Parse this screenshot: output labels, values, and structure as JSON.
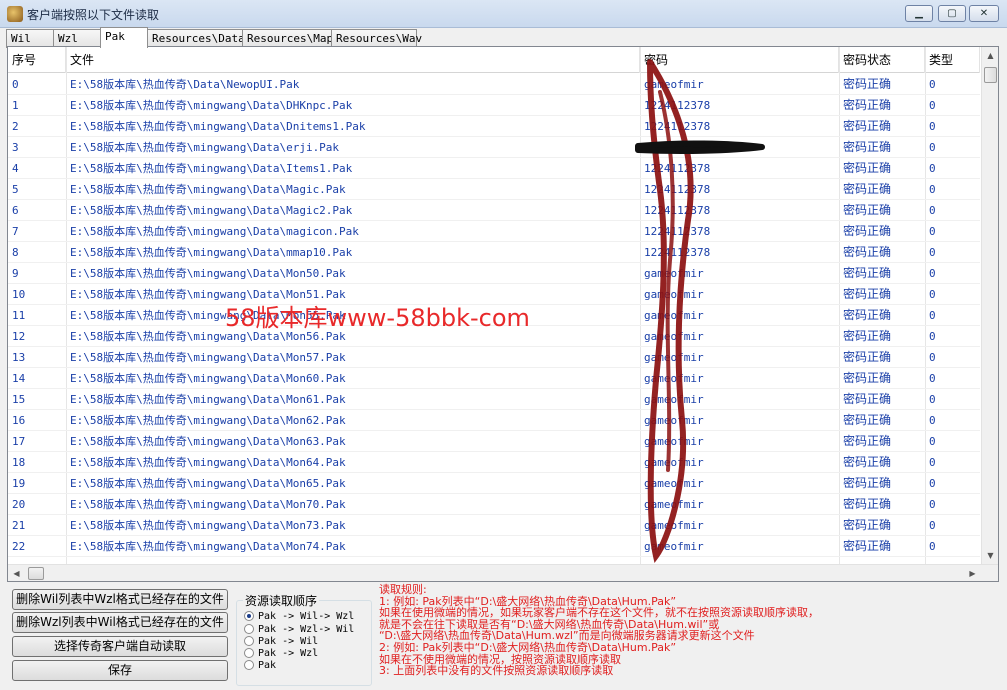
{
  "window": {
    "title": "客户端按照以下文件读取",
    "min_icon": "minimize-icon",
    "max_icon": "maximize-icon",
    "close_icon": "close-icon"
  },
  "tabs": [
    {
      "label": "Wil",
      "active": false
    },
    {
      "label": "Wzl",
      "active": false
    },
    {
      "label": "Pak",
      "active": true
    },
    {
      "label": "Resources\\Data",
      "active": false
    },
    {
      "label": "Resources\\Map",
      "active": false
    },
    {
      "label": "Resources\\Wav",
      "active": false
    }
  ],
  "table": {
    "headers": [
      "序号",
      "文件",
      "密码",
      "密码状态",
      "类型"
    ],
    "rows": [
      [
        "0",
        "E:\\58版本库\\热血传奇\\Data\\NewopUI.Pak",
        "gameofmir",
        "密码正确",
        "0"
      ],
      [
        "1",
        "E:\\58版本库\\热血传奇\\mingwang\\Data\\DHKnpc.Pak",
        "1224112378",
        "密码正确",
        "0"
      ],
      [
        "2",
        "E:\\58版本库\\热血传奇\\mingwang\\Data\\Dnitems1.Pak",
        "1224112378",
        "密码正确",
        "0"
      ],
      [
        "3",
        "E:\\58版本库\\热血传奇\\mingwang\\Data\\erji.Pak",
        "",
        "密码正确",
        "0"
      ],
      [
        "4",
        "E:\\58版本库\\热血传奇\\mingwang\\Data\\Items1.Pak",
        "1224112378",
        "密码正确",
        "0"
      ],
      [
        "5",
        "E:\\58版本库\\热血传奇\\mingwang\\Data\\Magic.Pak",
        "1224112378",
        "密码正确",
        "0"
      ],
      [
        "6",
        "E:\\58版本库\\热血传奇\\mingwang\\Data\\Magic2.Pak",
        "1224112378",
        "密码正确",
        "0"
      ],
      [
        "7",
        "E:\\58版本库\\热血传奇\\mingwang\\Data\\magicon.Pak",
        "1224112378",
        "密码正确",
        "0"
      ],
      [
        "8",
        "E:\\58版本库\\热血传奇\\mingwang\\Data\\mmap10.Pak",
        "1224112378",
        "密码正确",
        "0"
      ],
      [
        "9",
        "E:\\58版本库\\热血传奇\\mingwang\\Data\\Mon50.Pak",
        "gameofmir",
        "密码正确",
        "0"
      ],
      [
        "10",
        "E:\\58版本库\\热血传奇\\mingwang\\Data\\Mon51.Pak",
        "gameofmir",
        "密码正确",
        "0"
      ],
      [
        "11",
        "E:\\58版本库\\热血传奇\\mingwang\\Data\\Mon55.Pak",
        "gameofmir",
        "密码正确",
        "0"
      ],
      [
        "12",
        "E:\\58版本库\\热血传奇\\mingwang\\Data\\Mon56.Pak",
        "gameofmir",
        "密码正确",
        "0"
      ],
      [
        "13",
        "E:\\58版本库\\热血传奇\\mingwang\\Data\\Mon57.Pak",
        "gameofmir",
        "密码正确",
        "0"
      ],
      [
        "14",
        "E:\\58版本库\\热血传奇\\mingwang\\Data\\Mon60.Pak",
        "gameofmir",
        "密码正确",
        "0"
      ],
      [
        "15",
        "E:\\58版本库\\热血传奇\\mingwang\\Data\\Mon61.Pak",
        "gameofmir",
        "密码正确",
        "0"
      ],
      [
        "16",
        "E:\\58版本库\\热血传奇\\mingwang\\Data\\Mon62.Pak",
        "gameofmir",
        "密码正确",
        "0"
      ],
      [
        "17",
        "E:\\58版本库\\热血传奇\\mingwang\\Data\\Mon63.Pak",
        "gameofmir",
        "密码正确",
        "0"
      ],
      [
        "18",
        "E:\\58版本库\\热血传奇\\mingwang\\Data\\Mon64.Pak",
        "gameofmir",
        "密码正确",
        "0"
      ],
      [
        "19",
        "E:\\58版本库\\热血传奇\\mingwang\\Data\\Mon65.Pak",
        "gameofmir",
        "密码正确",
        "0"
      ],
      [
        "20",
        "E:\\58版本库\\热血传奇\\mingwang\\Data\\Mon70.Pak",
        "gameofmir",
        "密码正确",
        "0"
      ],
      [
        "21",
        "E:\\58版本库\\热血传奇\\mingwang\\Data\\Mon73.Pak",
        "gameofmir",
        "密码正确",
        "0"
      ],
      [
        "22",
        "E:\\58版本库\\热血传奇\\mingwang\\Data\\Mon74.Pak",
        "gameofmir",
        "密码正确",
        "0"
      ]
    ]
  },
  "watermark": "58版本库www-58bbk-com",
  "buttons": {
    "delete_wzl_in_wil": "删除Wil列表中Wzl格式已经存在的文件",
    "delete_wil_in_wzl": "删除Wzl列表中Wil格式已经存在的文件",
    "auto_read": "选择传奇客户端自动读取",
    "save": "保存"
  },
  "read_order": {
    "title": "资源读取顺序",
    "options": [
      {
        "label": "Pak -> Wil-> Wzl",
        "selected": true
      },
      {
        "label": "Pak -> Wzl-> Wil",
        "selected": false
      },
      {
        "label": "Pak -> Wil",
        "selected": false
      },
      {
        "label": "Pak -> Wzl",
        "selected": false
      },
      {
        "label": "Pak",
        "selected": false
      }
    ]
  },
  "rules": [
    "读取规则:",
    "1: 例如: Pak列表中“D:\\盛大网络\\热血传奇\\Data\\Hum.Pak”",
    "    如果在使用微端的情况，如果玩家客户端不存在这个文件，就不在按照资源读取顺序读取，",
    "    就是不会在往下读取是否有“D:\\盛大网络\\热血传奇\\Data\\Hum.wil”或",
    "  “D:\\盛大网络\\热血传奇\\Data\\Hum.wzl”而是向微端服务器请求更新这个文件",
    "2: 例如: Pak列表中“D:\\盛大网络\\热血传奇\\Data\\Hum.Pak”",
    "    如果在不使用微端的情况，按照资源读取顺序读取",
    "3: 上面列表中没有的文件按照资源读取顺序读取"
  ],
  "colors": {
    "link_text": "#1a3fa8",
    "rules_text": "#e02020",
    "watermark": "#e8292a",
    "scribble": "#8b0f0f"
  }
}
